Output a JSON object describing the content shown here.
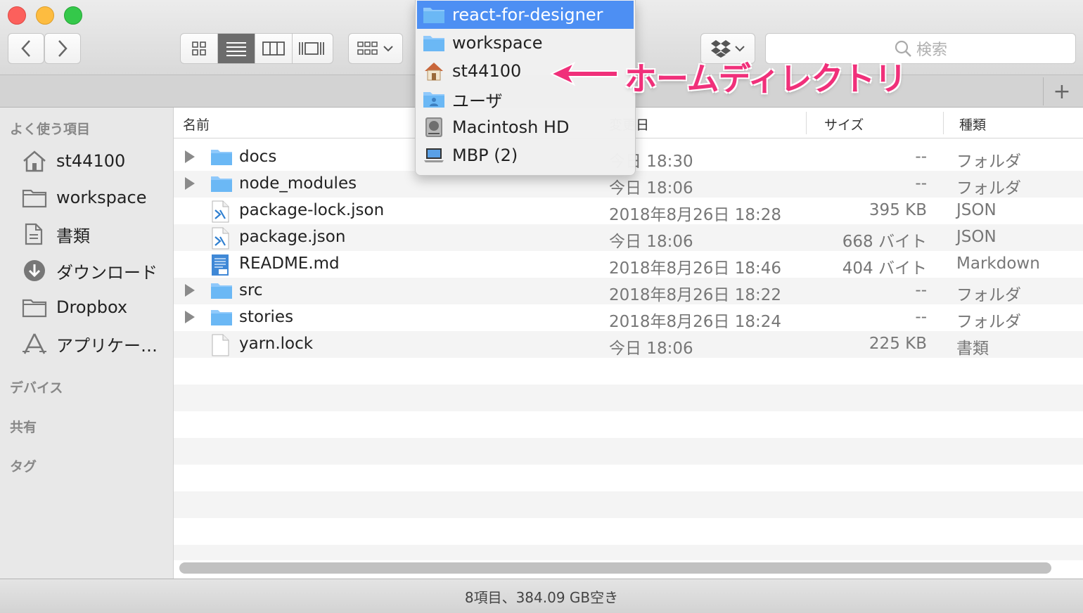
{
  "toolbar": {
    "search_placeholder": "検索"
  },
  "sidebar": {
    "favorites_header": "よく使う項目",
    "items": [
      {
        "label": "st44100",
        "icon": "home-icon"
      },
      {
        "label": "workspace",
        "icon": "folder-icon"
      },
      {
        "label": "書類",
        "icon": "documents-icon"
      },
      {
        "label": "ダウンロード",
        "icon": "download-icon"
      },
      {
        "label": "Dropbox",
        "icon": "folder-icon"
      },
      {
        "label": "アプリケー…",
        "icon": "applications-icon"
      }
    ],
    "devices_header": "デバイス",
    "shared_header": "共有",
    "tags_header": "タグ"
  },
  "columns": {
    "name": "名前",
    "date": "変更日",
    "size": "サイズ",
    "kind": "種類"
  },
  "files": [
    {
      "name": "docs",
      "date": "今日 18:30",
      "size": "--",
      "kind": "フォルダ",
      "type": "folder"
    },
    {
      "name": "node_modules",
      "date": "今日 18:06",
      "size": "--",
      "kind": "フォルダ",
      "type": "folder"
    },
    {
      "name": "package-lock.json",
      "date": "2018年8月26日 18:28",
      "size": "395 KB",
      "kind": "JSON",
      "type": "json"
    },
    {
      "name": "package.json",
      "date": "今日 18:06",
      "size": "668 バイト",
      "kind": "JSON",
      "type": "json"
    },
    {
      "name": "README.md",
      "date": "2018年8月26日 18:46",
      "size": "404 バイト",
      "kind": "Markdown",
      "type": "markdown"
    },
    {
      "name": "src",
      "date": "2018年8月26日 18:22",
      "size": "--",
      "kind": "フォルダ",
      "type": "folder"
    },
    {
      "name": "stories",
      "date": "2018年8月26日 18:24",
      "size": "--",
      "kind": "フォルダ",
      "type": "folder"
    },
    {
      "name": "yarn.lock",
      "date": "今日 18:06",
      "size": "225 KB",
      "kind": "書類",
      "type": "document"
    }
  ],
  "path_menu": [
    {
      "label": "react-for-designer",
      "icon": "folder-icon",
      "selected": true
    },
    {
      "label": "workspace",
      "icon": "folder-icon",
      "selected": false
    },
    {
      "label": "st44100",
      "icon": "home-icon",
      "selected": false
    },
    {
      "label": "ユーザ",
      "icon": "users-folder-icon",
      "selected": false
    },
    {
      "label": "Macintosh HD",
      "icon": "hard-drive-icon",
      "selected": false
    },
    {
      "label": "MBP (2)",
      "icon": "laptop-icon",
      "selected": false
    }
  ],
  "annotation": {
    "text": "ホームディレクトリ",
    "color": "#f0307a"
  },
  "status_bar": {
    "text": "8項目、384.09 GB空き"
  },
  "colors": {
    "accent": "#4d8ff3",
    "folder": "#6bb8f5"
  }
}
